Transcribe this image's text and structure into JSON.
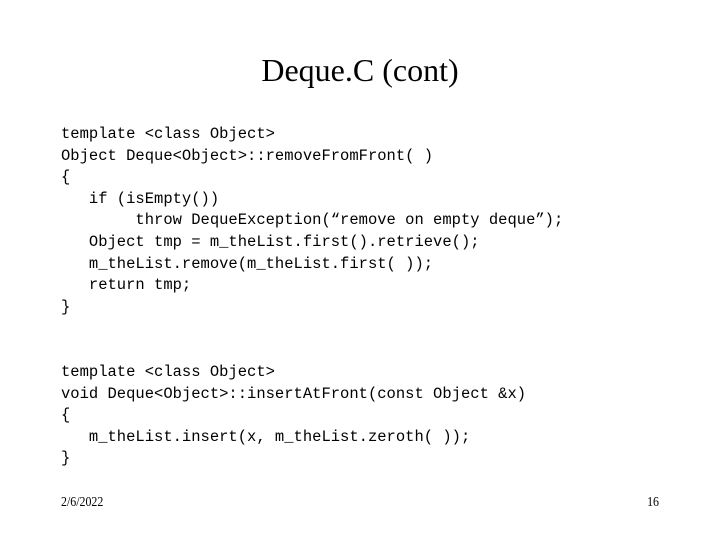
{
  "slide": {
    "title": "Deque.C (cont)",
    "code_blocks": [
      {
        "lines": [
          "template <class Object>",
          "Object Deque<Object>::removeFromFront( )",
          "{",
          "   if (isEmpty())",
          "        throw DequeException(“remove on empty deque”);",
          "   Object tmp = m_theList.first().retrieve();",
          "   m_theList.remove(m_theList.first( ));",
          "   return tmp;",
          "}"
        ]
      },
      {
        "lines": [
          "template <class Object>",
          "void Deque<Object>::insertAtFront(const Object &x)",
          "{",
          "   m_theList.insert(x, m_theList.zeroth( ));",
          "}"
        ]
      }
    ],
    "footer": {
      "date": "2/6/2022",
      "page_number": "16"
    }
  }
}
